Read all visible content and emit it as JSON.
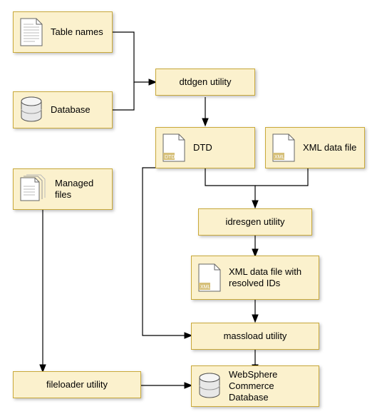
{
  "nodes": {
    "table_names": {
      "label": "Table names"
    },
    "database_in": {
      "label": "Database"
    },
    "managed_files": {
      "label": "Managed files"
    },
    "dtdgen": {
      "label": "dtdgen utility"
    },
    "dtd": {
      "label": "DTD",
      "doc_badge": "DTD"
    },
    "xml_data_file": {
      "label": "XML data file",
      "doc_badge": "XML"
    },
    "idresgen": {
      "label": "idresgen utility"
    },
    "xml_resolved": {
      "label": "XML data file with resolved IDs",
      "doc_badge": "XML"
    },
    "massload": {
      "label": "massload utility"
    },
    "fileloader": {
      "label": "fileloader utility"
    },
    "wc_database": {
      "label": "WebSphere Commerce Database"
    }
  },
  "colors": {
    "box_fill": "#fbf1cd",
    "box_border": "#c9a93a",
    "arrow": "#000000"
  }
}
